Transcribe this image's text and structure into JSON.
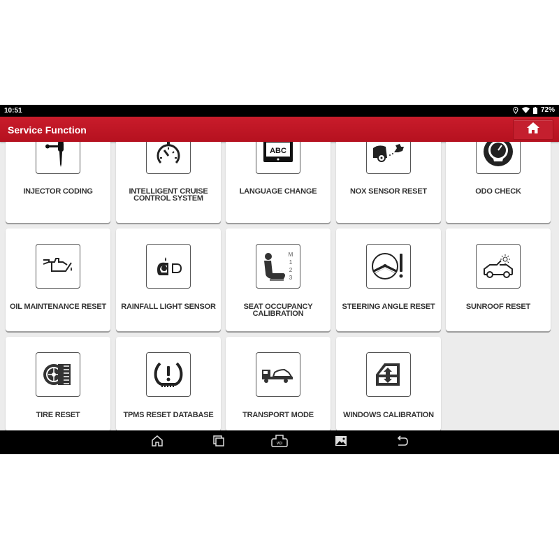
{
  "status_bar": {
    "time": "10:51",
    "battery": "72%",
    "icons": [
      "location-icon",
      "wifi-icon",
      "battery-icon"
    ]
  },
  "header": {
    "title": "Service Function",
    "home_button": "home-icon"
  },
  "colors": {
    "header_red": "#c41f2e",
    "background": "#ececec",
    "card": "#ffffff",
    "icon": "#333333"
  },
  "functions": [
    {
      "label": "INJECTOR CODING",
      "icon": "injector-icon"
    },
    {
      "label": "INTELLIGENT CRUISE CONTROL SYSTEM",
      "icon": "cruise-control-icon"
    },
    {
      "label": "LANGUAGE CHANGE",
      "icon": "language-abc-icon"
    },
    {
      "label": "NOX SENSOR RESET",
      "icon": "nox-sensor-icon"
    },
    {
      "label": "ODO CHECK",
      "icon": "odometer-icon"
    },
    {
      "label": "OIL MAINTENANCE RESET",
      "icon": "oil-can-icon"
    },
    {
      "label": "RAINFALL LIGHT SENSOR",
      "icon": "rain-light-sensor-icon"
    },
    {
      "label": "SEAT OCCUPANCY CALIBRATION",
      "icon": "seat-icon",
      "seat_positions": [
        "M",
        "1",
        "2",
        "3"
      ]
    },
    {
      "label": "STEERING ANGLE RESET",
      "icon": "steering-wheel-icon"
    },
    {
      "label": "SUNROOF RESET",
      "icon": "sunroof-car-icon"
    },
    {
      "label": "TIRE RESET",
      "icon": "tire-icon"
    },
    {
      "label": "TPMS RESET DATABASE",
      "icon": "tpms-icon"
    },
    {
      "label": "TRANSPORT MODE",
      "icon": "tow-truck-icon"
    },
    {
      "label": "WINDOWS CALIBRATION",
      "icon": "window-icon"
    }
  ],
  "language_icon_text": "ABC",
  "nav_bar": {
    "buttons": [
      "home-icon",
      "recent-apps-icon",
      "vci-icon",
      "gallery-icon",
      "back-icon"
    ],
    "vci_text": "VCI"
  }
}
